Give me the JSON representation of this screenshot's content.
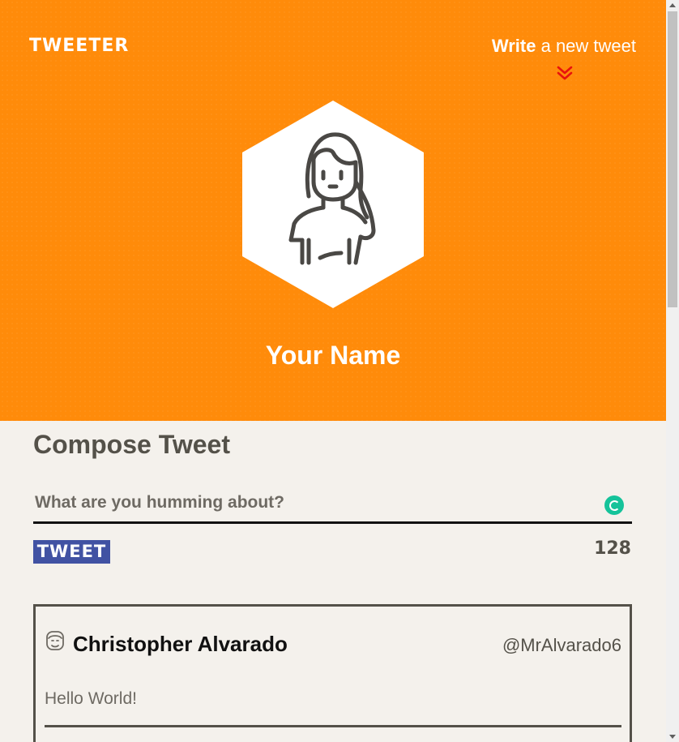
{
  "nav": {
    "logo": "TWEETER",
    "write_bold": "Write",
    "write_rest": " a new tweet",
    "chevron_icon": "double-chevron-down-icon",
    "chevron_color": "#e8120c",
    "background_color": "#ff8b0a"
  },
  "profile": {
    "avatar_icon": "woman-avatar-icon",
    "name": "Your Name"
  },
  "compose": {
    "title": "Compose Tweet",
    "placeholder": "What are you humming about?",
    "value": "",
    "button_label": "TWEET",
    "button_color": "#4152a3",
    "counter": "128",
    "grammar_icon": "grammarly-icon"
  },
  "tweets": [
    {
      "avatar_icon": "man-avatar-icon",
      "name": "Christopher Alvarado",
      "handle": "@MrAlvarado6",
      "content": "Hello World!"
    }
  ]
}
